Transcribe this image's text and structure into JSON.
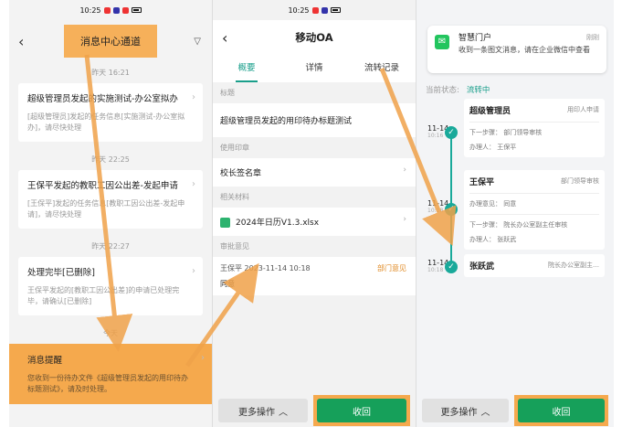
{
  "status_time": "10:25",
  "panel1": {
    "nav_title": "消息中心通道",
    "items": [
      {
        "time": "昨天 16:21",
        "title": "超级管理员发起的实施测试-办公室拟办",
        "desc": "[超级管理员]发起的任务信息[实施测试-办公室拟办]，请尽快处理"
      },
      {
        "time": "昨天 22:25",
        "title": "王保平发起的教职工因公出差-发起申请",
        "desc": "[王保平]发起的任务信息[教职工因公出差-发起申请]，请尽快处理"
      },
      {
        "time": "昨天 22:27",
        "title": "处理完毕[已删除]",
        "desc": "王保平发起的[教职工因公出差]的申请已处理完毕，请确认[已删除]"
      },
      {
        "time": "今天",
        "title": "消息提醒",
        "desc": "您收到一份待办文件《超级管理员发起的用印待办标题测试》，请及时处理。"
      }
    ]
  },
  "panel2": {
    "nav_title": "移动OA",
    "tabs": [
      "概要",
      "详情",
      "流转记录"
    ],
    "sec_title": "标题",
    "title_value": "超级管理员发起的用印待办标题测试",
    "sec_seal": "使用印章",
    "seal_value": "校长签名章",
    "sec_material": "相关材料",
    "material_value": "2024年日历V1.3.xlsx",
    "sec_opinion": "审批意见",
    "opinion_who": "王保平 2023-11-14 10:18",
    "opinion_tag": "部门意见",
    "opinion_text": "同意",
    "more_label": "更多操作",
    "submit_label": "收回"
  },
  "panel3": {
    "notif_title": "智慧门户",
    "notif_time": "刚刚",
    "notif_body": "收到一条图文消息，请在企业微信中查看",
    "state_label": "当前状态:",
    "state_value": "流转中",
    "timeline": [
      {
        "date": "11-14",
        "time": "10:16",
        "name": "超级管理员",
        "role": "用印人申请",
        "line1": "下一步骤：  部门领导审核",
        "line2": "办理人：  王保平"
      },
      {
        "date": "11-14",
        "time": "10:18",
        "name": "王保平",
        "role": "部门领导审核",
        "line1": "办理意见：  同意",
        "line2": "下一步骤：  院长办公室副主任审核",
        "line3": "办理人：  张跃武"
      },
      {
        "date": "11-14",
        "time": "10:18",
        "name": "张跃武",
        "role": "院长办公室副主…"
      }
    ],
    "more_label": "更多操作",
    "submit_label": "收回"
  }
}
